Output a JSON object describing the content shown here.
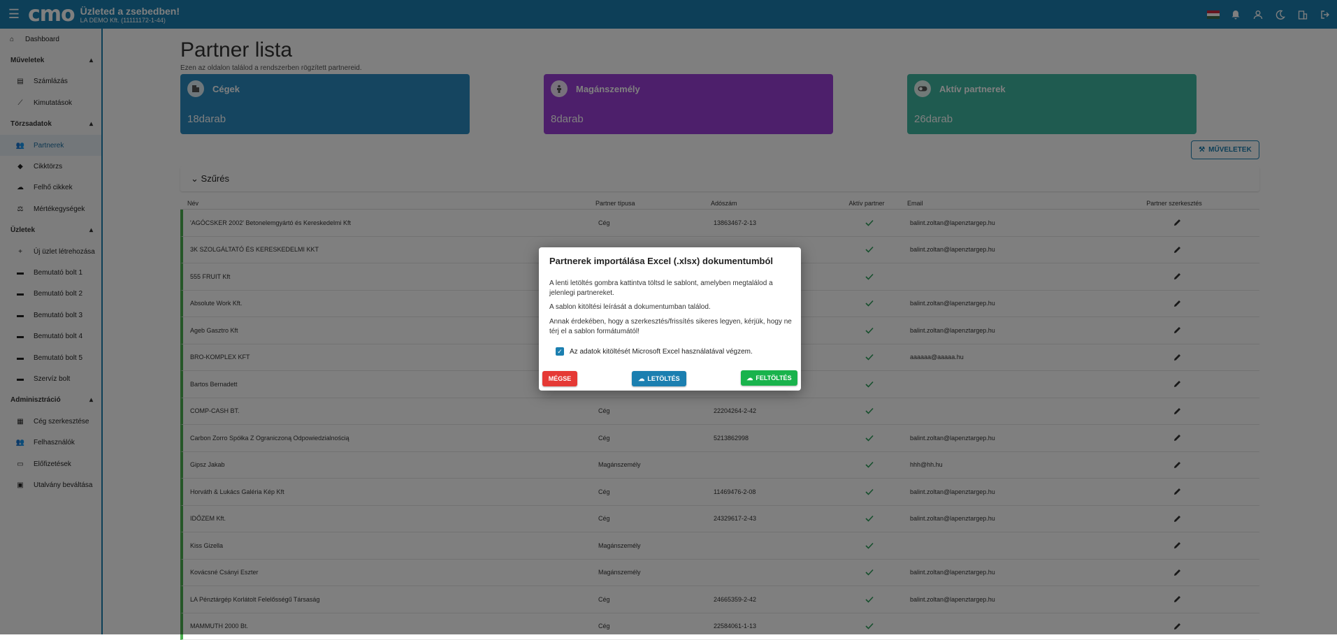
{
  "topbar": {
    "logo": "cmo",
    "title": "Üzleted a zsebedben!",
    "company": "LA DEMO Kft. (11111172-1-44)"
  },
  "sidebar": {
    "dashboard": "Dashboard",
    "sections": [
      {
        "label": "Műveletek",
        "items": [
          "Számlázás",
          "Kimutatások"
        ]
      },
      {
        "label": "Törzsadatok",
        "items": [
          "Partnerek",
          "Cikktörzs",
          "Felhő cikkek",
          "Mértékegységek"
        ]
      },
      {
        "label": "Üzletek",
        "items": [
          "Új üzlet létrehozása",
          "Bemutató bolt 1",
          "Bemutató bolt 2",
          "Bemutató bolt 3",
          "Bemutató bolt 4",
          "Bemutató bolt 5",
          "Szervíz bolt"
        ]
      },
      {
        "label": "Adminisztráció",
        "items": [
          "Cég szerkesztése",
          "Felhasználók",
          "Előfizetések",
          "Utalvány beváltása"
        ]
      }
    ]
  },
  "page": {
    "title": "Partner lista",
    "subtitle": "Ezen az oldalon találod a rendszerben rögzített partnereid."
  },
  "cards": [
    {
      "title": "Cégek",
      "value": "18darab",
      "color": "#2a8bc0"
    },
    {
      "title": "Magánszemély",
      "value": "8darab",
      "color": "#9b3fd6"
    },
    {
      "title": "Aktív partnerek",
      "value": "26darab",
      "color": "#3fb6a0"
    }
  ],
  "actions_button": "MŰVELETEK",
  "filter_label": "Szűrés",
  "table": {
    "headers": [
      "Név",
      "Partner típusa",
      "Adószám",
      "Aktív partner",
      "Email",
      "Partner szerkesztés"
    ],
    "rows": [
      {
        "name": "'AGÓCSKER 2002' Betonelemgyártó és Kereskedelmi Kft",
        "type": "Cég",
        "tax": "13863467-2-13",
        "email": "balint.zoltan@lapenztargep.hu"
      },
      {
        "name": "3K SZOLGÁLTATÓ ÉS KERESKEDELMI KKT",
        "type": "",
        "tax": "",
        "email": "balint.zoltan@lapenztargep.hu"
      },
      {
        "name": "555 FRUIT Kft",
        "type": "",
        "tax": "",
        "email": ""
      },
      {
        "name": "Absolute Work Kft.",
        "type": "",
        "tax": "",
        "email": "balint.zoltan@lapenztargep.hu"
      },
      {
        "name": "Ageb Gasztro Kft",
        "type": "",
        "tax": "",
        "email": "balint.zoltan@lapenztargep.hu"
      },
      {
        "name": "BRO-KOMPLEX KFT",
        "type": "",
        "tax": "",
        "email": "aaaaaa@aaaaa.hu"
      },
      {
        "name": "Bartos Bernadett",
        "type": "",
        "tax": "",
        "email": ""
      },
      {
        "name": "COMP-CASH BT.",
        "type": "Cég",
        "tax": "22204264-2-42",
        "email": ""
      },
      {
        "name": "Carbon Zorro Spółka Z Ograniczoną Odpowiedzialnością",
        "type": "Cég",
        "tax": "5213862998",
        "email": "balint.zoltan@lapenztargep.hu"
      },
      {
        "name": "Gipsz Jakab",
        "type": "Magánszemély",
        "tax": "",
        "email": "hhh@hh.hu"
      },
      {
        "name": "Horváth & Lukács Galéria Kép Kft",
        "type": "Cég",
        "tax": "11469476-2-08",
        "email": "balint.zoltan@lapenztargep.hu"
      },
      {
        "name": "IDŐZEM Kft.",
        "type": "Cég",
        "tax": "24329617-2-43",
        "email": "balint.zoltan@lapenztargep.hu"
      },
      {
        "name": "Kiss Gizella",
        "type": "Magánszemély",
        "tax": "",
        "email": ""
      },
      {
        "name": "Kovácsné Csányi Eszter",
        "type": "Magánszemély",
        "tax": "",
        "email": "balint.zoltan@lapenztargep.hu"
      },
      {
        "name": "LA Pénztárgép Korlátolt Felelősségű Társaság",
        "type": "Cég",
        "tax": "24665359-2-42",
        "email": "balint.zoltan@lapenztargep.hu"
      },
      {
        "name": "MAMMUTH 2000 Bt.",
        "type": "Cég",
        "tax": "22584061-1-13",
        "email": ""
      }
    ]
  },
  "modal": {
    "title": "Partnerek importálása Excel (.xlsx) dokumentumból",
    "p1": "A lenti letöltés gombra kattintva töltsd le sablont, amelyben megtalálod a jelenlegi partnereket.",
    "p2": "A sablon kitöltési leírását a dokumentumban találod.",
    "p3": "Annak érdekében, hogy a szerkesztés/frissítés sikeres legyen, kérjük, hogy ne térj el a sablon formátumától!",
    "checkbox": "Az adatok kitöltését Microsoft Excel használatával végzem.",
    "cancel": "MÉGSE",
    "download": "LETÖLTÉS",
    "upload": "FELTÖLTÉS"
  }
}
